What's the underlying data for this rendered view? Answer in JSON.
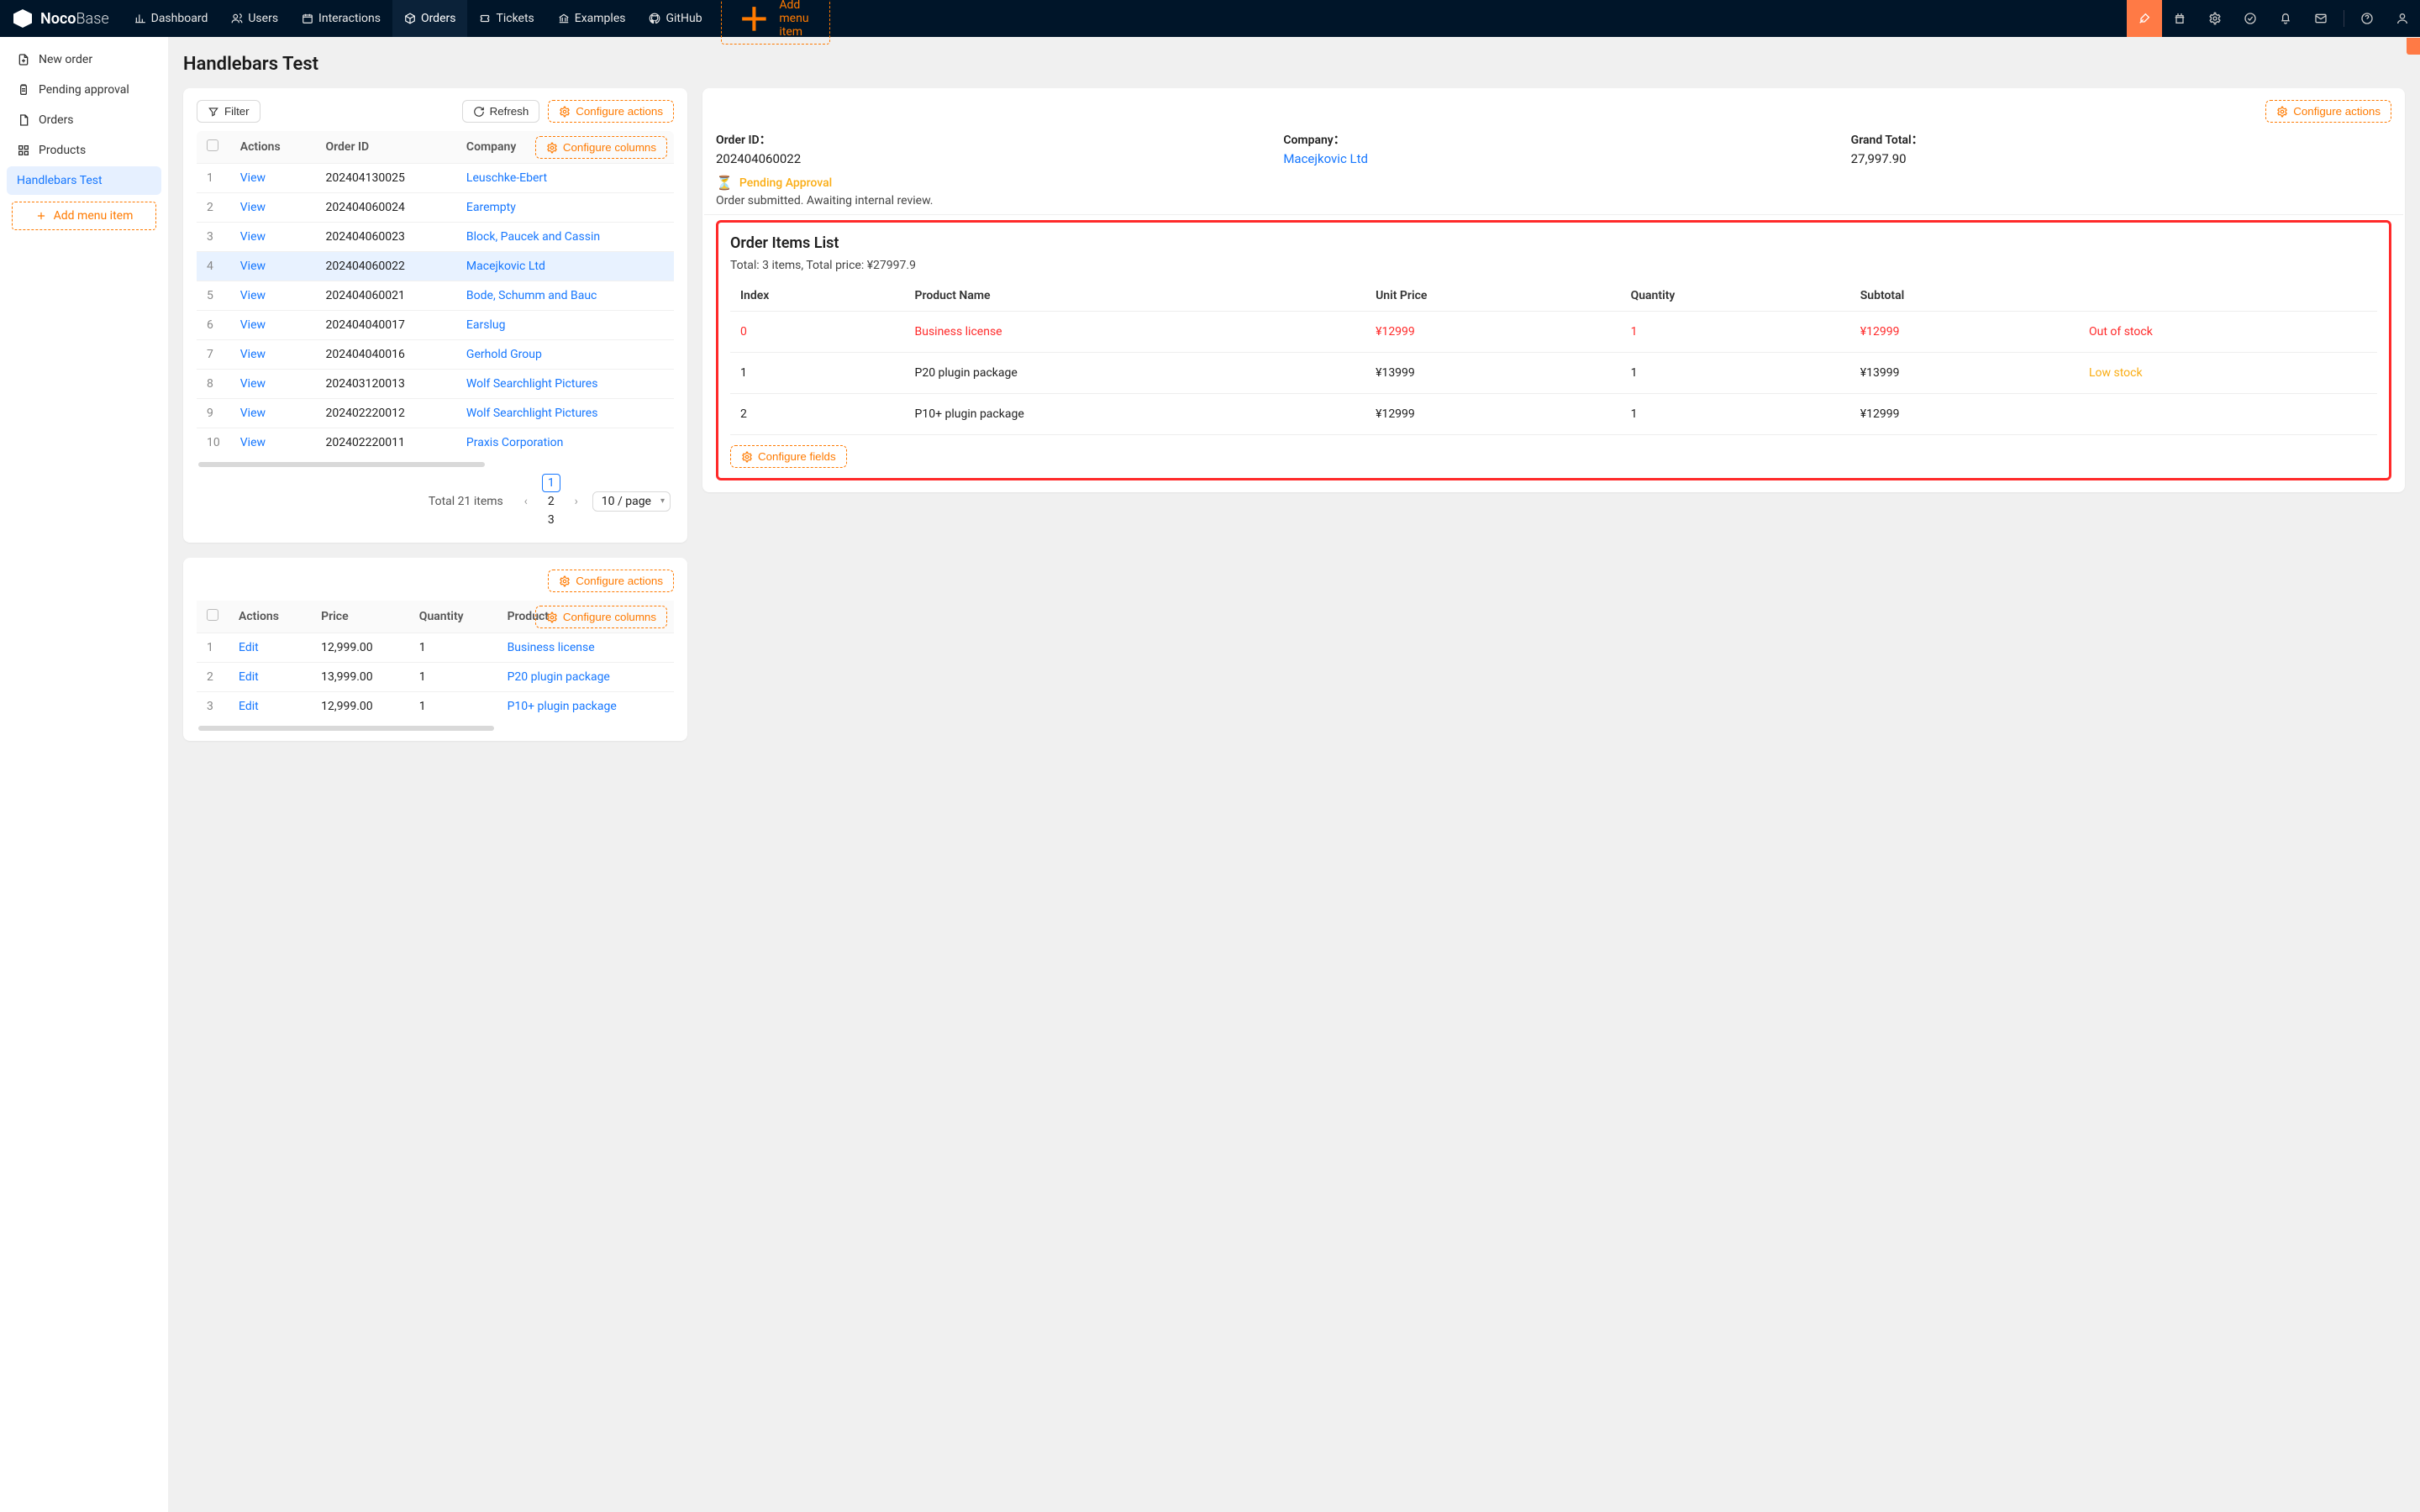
{
  "brand": {
    "name1": "Noco",
    "name2": "Base"
  },
  "topnav": [
    {
      "label": "Dashboard",
      "icon": "bar-chart"
    },
    {
      "label": "Users",
      "icon": "users"
    },
    {
      "label": "Interactions",
      "icon": "calendar"
    },
    {
      "label": "Orders",
      "icon": "package",
      "active": true
    },
    {
      "label": "Tickets",
      "icon": "ticket"
    },
    {
      "label": "Examples",
      "icon": "bank"
    },
    {
      "label": "GitHub",
      "icon": "github"
    }
  ],
  "addMenuItem": "Add menu item",
  "sidebar": [
    {
      "label": "New order",
      "icon": "file-plus"
    },
    {
      "label": "Pending approval",
      "icon": "clipboard"
    },
    {
      "label": "Orders",
      "icon": "page"
    },
    {
      "label": "Products",
      "icon": "grid"
    },
    {
      "label": "Handlebars Test",
      "icon": null,
      "active": true
    }
  ],
  "pageTitle": "Handlebars Test",
  "leftCard": {
    "filter": "Filter",
    "refresh": "Refresh",
    "configureActions": "Configure actions",
    "configureColumns": "Configure columns",
    "columns": [
      "",
      "Actions",
      "Order ID",
      "Company"
    ],
    "rows": [
      {
        "n": "1",
        "action": "View",
        "id": "202404130025",
        "company": "Leuschke-Ebert"
      },
      {
        "n": "2",
        "action": "View",
        "id": "202404060024",
        "company": "Earempty"
      },
      {
        "n": "3",
        "action": "View",
        "id": "202404060023",
        "company": "Block, Paucek and Cassin"
      },
      {
        "n": "4",
        "action": "View",
        "id": "202404060022",
        "company": "Macejkovic Ltd",
        "selected": true
      },
      {
        "n": "5",
        "action": "View",
        "id": "202404060021",
        "company": "Bode, Schumm and Bauc"
      },
      {
        "n": "6",
        "action": "View",
        "id": "202404040017",
        "company": "Earslug"
      },
      {
        "n": "7",
        "action": "View",
        "id": "202404040016",
        "company": "Gerhold Group"
      },
      {
        "n": "8",
        "action": "View",
        "id": "202403120013",
        "company": "Wolf Searchlight Pictures"
      },
      {
        "n": "9",
        "action": "View",
        "id": "202402220012",
        "company": "Wolf Searchlight Pictures"
      },
      {
        "n": "10",
        "action": "View",
        "id": "202402220011",
        "company": "Praxis Corporation"
      }
    ],
    "pagination": {
      "totalText": "Total 21 items",
      "pages": [
        "1",
        "2",
        "3"
      ],
      "active": "1",
      "perPage": "10 / page"
    }
  },
  "rightCard": {
    "configureActions": "Configure actions",
    "labels": {
      "orderId": "Order ID：",
      "company": "Company：",
      "grandTotal": "Grand Total："
    },
    "values": {
      "orderId": "202404060022",
      "company": "Macejkovic Ltd",
      "grandTotal": "27,997.90"
    },
    "status": {
      "emoji": "⏳",
      "text": "Pending Approval"
    },
    "note": "Order submitted. Awaiting internal review.",
    "itemsList": {
      "title": "Order Items List",
      "summary": "Total: 3 items, Total price: ¥27997.9",
      "columns": [
        "Index",
        "Product Name",
        "Unit Price",
        "Quantity",
        "Subtotal",
        ""
      ],
      "rows": [
        {
          "index": "0",
          "name": "Business license",
          "price": "¥12999",
          "qty": "1",
          "sub": "¥12999",
          "flag": "Out of stock",
          "flagClass": "red",
          "rowRed": true
        },
        {
          "index": "1",
          "name": "P20 plugin package",
          "price": "¥13999",
          "qty": "1",
          "sub": "¥13999",
          "flag": "Low stock",
          "flagClass": "orange"
        },
        {
          "index": "2",
          "name": "P10+ plugin package",
          "price": "¥12999",
          "qty": "1",
          "sub": "¥12999",
          "flag": ""
        }
      ],
      "configureFields": "Configure fields"
    }
  },
  "bottomCard": {
    "configureActions": "Configure actions",
    "configureColumns": "Configure columns",
    "columns": [
      "",
      "Actions",
      "Price",
      "Quantity",
      "Product"
    ],
    "rows": [
      {
        "n": "1",
        "action": "Edit",
        "price": "12,999.00",
        "qty": "1",
        "product": "Business license"
      },
      {
        "n": "2",
        "action": "Edit",
        "price": "13,999.00",
        "qty": "1",
        "product": "P20 plugin package"
      },
      {
        "n": "3",
        "action": "Edit",
        "price": "12,999.00",
        "qty": "1",
        "product": "P10+ plugin package"
      }
    ]
  }
}
